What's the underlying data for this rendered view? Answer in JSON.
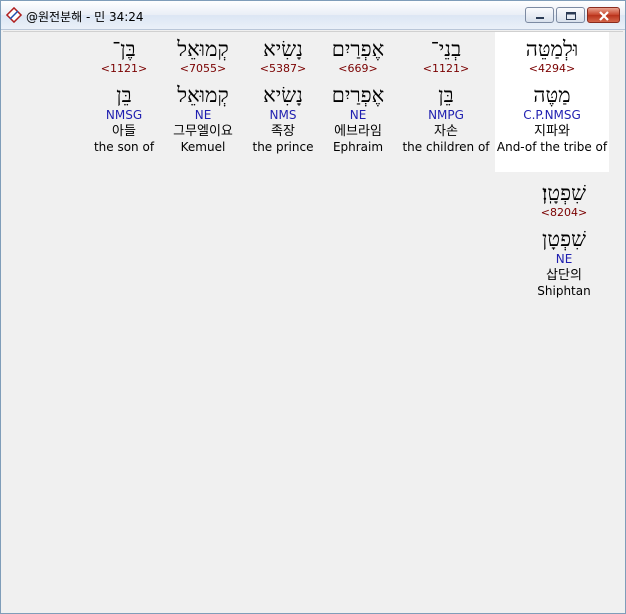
{
  "window": {
    "title": "@원전분해 - 민 34:24",
    "controls": {
      "minimize": "minimize-icon",
      "maximize": "maximize-icon",
      "close": "close-icon"
    }
  },
  "words": [
    {
      "hebrew": "וּלְמַטֵּה",
      "strong": "<4294>",
      "lemma": "מַטֶּה",
      "parsing": "C.P.NMSG",
      "korean": "지파와",
      "english": "And-of the tribe of",
      "selected": true
    },
    {
      "hebrew": "בְנֵי־",
      "strong": "<1121>",
      "lemma": "בֵּן",
      "parsing": "NMPG",
      "korean": "자손",
      "english": "the children of",
      "selected": false
    },
    {
      "hebrew": "אֶפְרַיִם",
      "strong": "<669>",
      "lemma": "אֶפְרַיִם",
      "parsing": "NE",
      "korean": "에브라임",
      "english": "Ephraim",
      "selected": false
    },
    {
      "hebrew": "נָשִׂיא",
      "strong": "<5387>",
      "lemma": "נָשִׂיא",
      "parsing": "NMS",
      "korean": "족장",
      "english": "the prince",
      "selected": false
    },
    {
      "hebrew": "קְמוּאֵל",
      "strong": "<7055>",
      "lemma": "קְמוּאֵל",
      "parsing": "NE",
      "korean": "그무엘이요",
      "english": "Kemuel",
      "selected": false
    },
    {
      "hebrew": "בֶּן־",
      "strong": "<1121>",
      "lemma": "בֵּן",
      "parsing": "NMSG",
      "korean": "아들",
      "english": "the son of",
      "selected": false
    },
    {
      "hebrew": "שִׁפְטָֽן׃",
      "strong": "<8204>",
      "lemma": "שִׁפְטָן",
      "parsing": "NE",
      "korean": "삽단의",
      "english": "Shiphtan",
      "selected": false
    }
  ]
}
